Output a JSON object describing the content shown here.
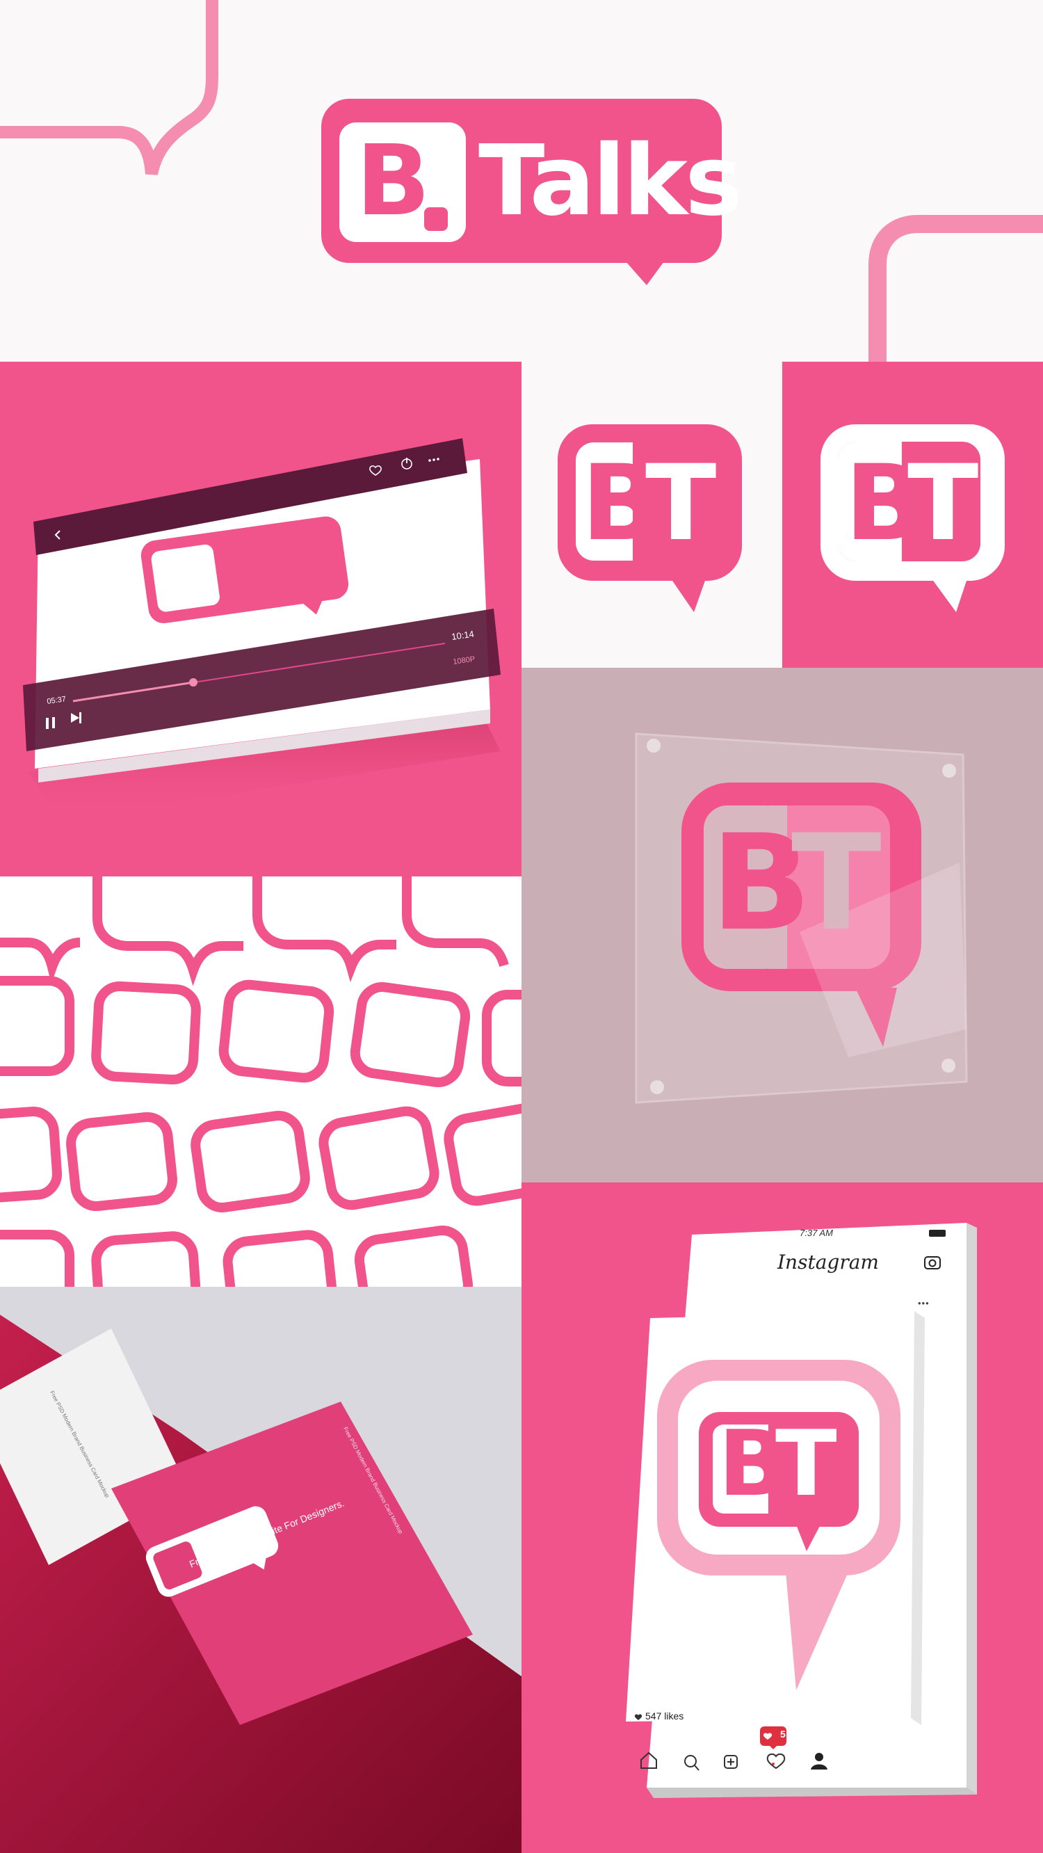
{
  "brand": {
    "name_part_1": "B",
    "name_part_2": "Talks",
    "monogram_1": "B",
    "monogram_2": "T",
    "colors": {
      "primary_pink": "#f0548a",
      "light_pink": "#f58db0",
      "pale_pink": "#f7a9c3",
      "dark_plum": "#5b1a3a",
      "glass_bg": "#c9aeb6",
      "paper": "#fbf8fa"
    }
  },
  "video_player": {
    "back_icon": "chevron-left-icon",
    "heart_icon": "heart-icon",
    "power_icon": "power-icon",
    "more_icon": "more-horizontal-icon",
    "time_end": "10:14",
    "quality": "1080P",
    "time_current": "05:37",
    "progress_fraction": 0.33
  },
  "business_card": {
    "headline": "Free Mockups Website For Designers.",
    "side_text": "Free PSD Modern Brand Business Card Mockup",
    "back_side_text": "Free PSD Modern Brand Business Card Mockup"
  },
  "instagram": {
    "time": "7:37 AM",
    "title": "Instagram",
    "more": "•••",
    "likes": "547 likes",
    "notification_count": "5"
  }
}
